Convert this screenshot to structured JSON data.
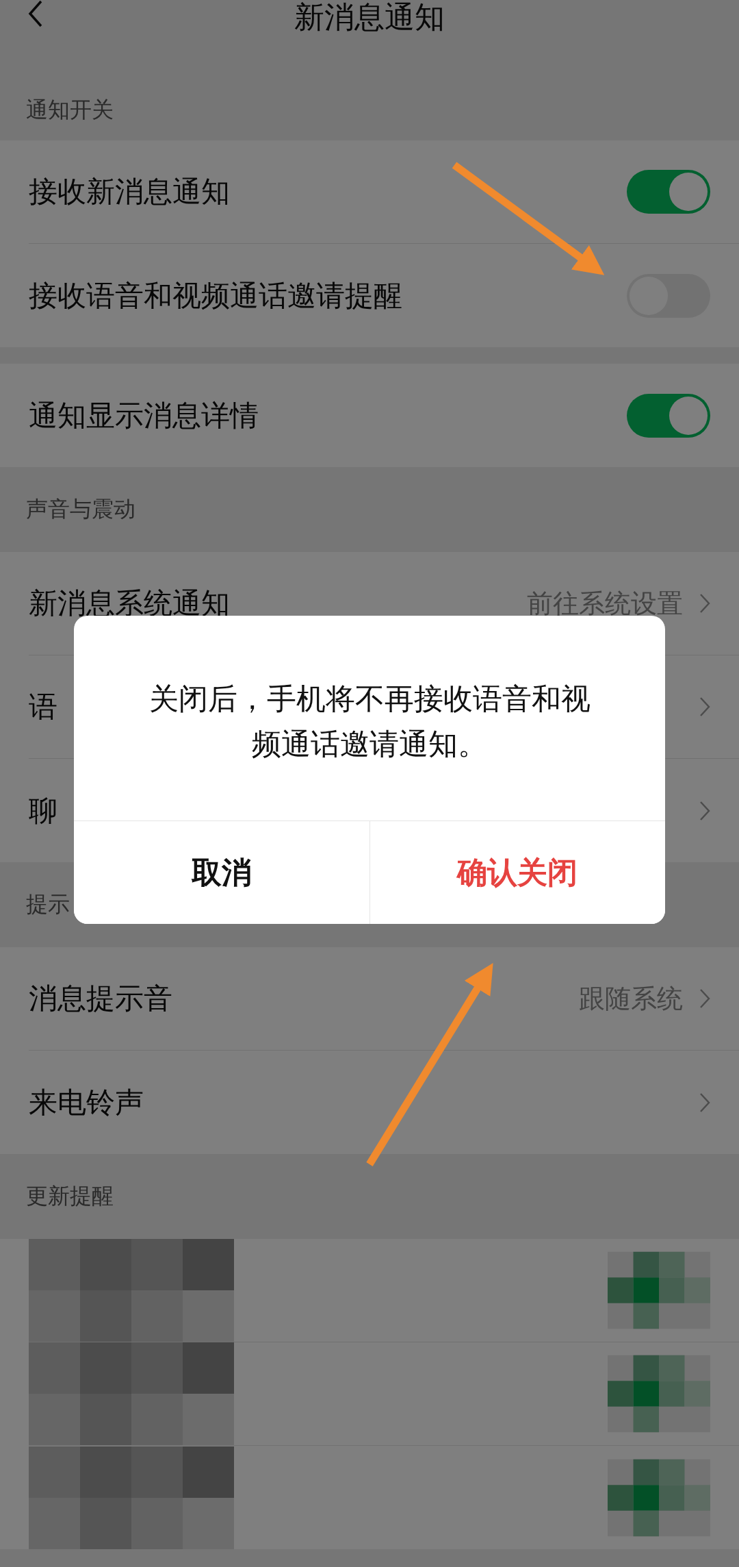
{
  "nav": {
    "title": "新消息通知"
  },
  "sections": [
    {
      "header": "通知开关",
      "rows": [
        {
          "kind": "toggle",
          "label": "接收新消息通知",
          "on": true
        },
        {
          "kind": "toggle",
          "label": "接收语音和视频通话邀请提醒",
          "on": false
        }
      ]
    },
    {
      "rows": [
        {
          "kind": "toggle",
          "label": "通知显示消息详情",
          "on": true
        }
      ]
    },
    {
      "header": "声音与震动",
      "rows": [
        {
          "kind": "link",
          "label": "新消息系统通知",
          "value": "前往系统设置"
        },
        {
          "kind": "link",
          "label": "语"
        },
        {
          "kind": "link",
          "label": "聊"
        }
      ]
    },
    {
      "header": "提示",
      "rows": [
        {
          "kind": "link",
          "label": "消息提示音",
          "value": "跟随系统"
        },
        {
          "kind": "link",
          "label": "来电铃声"
        }
      ]
    },
    {
      "header": "更新提醒",
      "rows": [
        {
          "kind": "redacted"
        },
        {
          "kind": "redacted"
        },
        {
          "kind": "redacted"
        }
      ]
    }
  ],
  "dialog": {
    "message": "关闭后，手机将不再接收语音和视频通话邀请通知。",
    "buttons": [
      {
        "label": "取消",
        "kind": "cancel"
      },
      {
        "label": "确认关闭",
        "kind": "danger"
      }
    ]
  }
}
